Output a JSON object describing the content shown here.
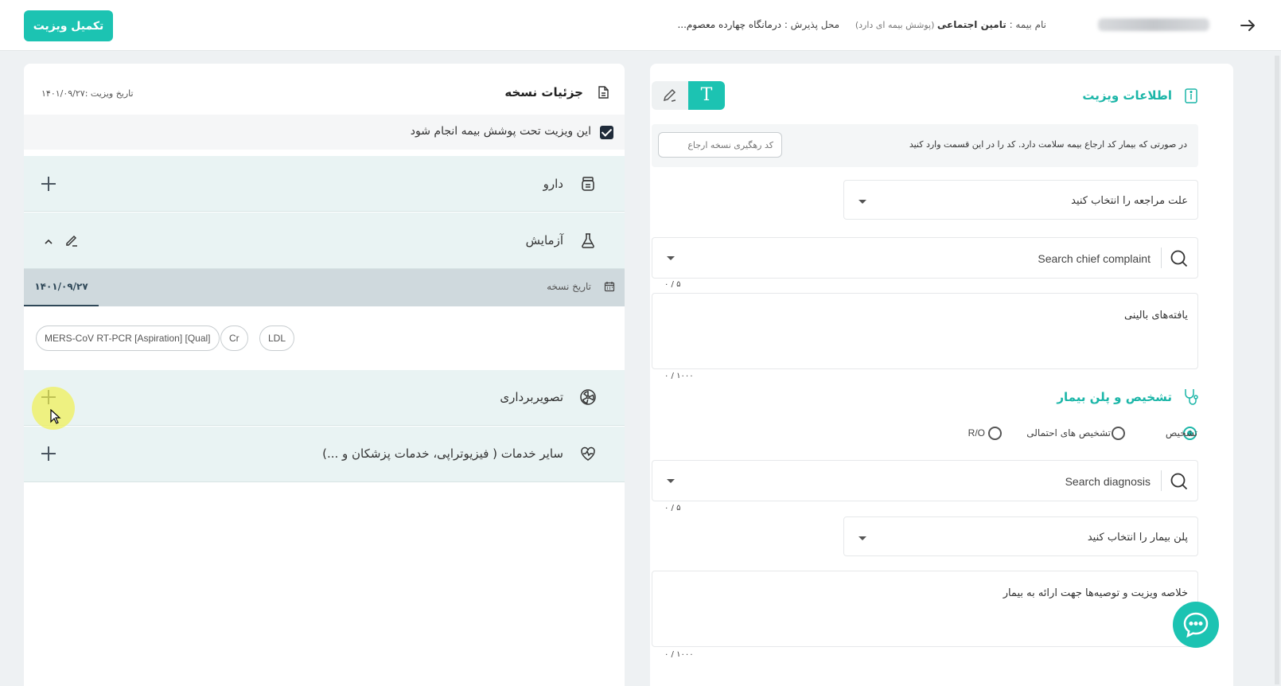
{
  "topbar": {
    "complete_visit_label": "تکمیل ویزیت",
    "insurance_label": "نام بیمه : ",
    "insurance_value": "تامین اجتماعی",
    "insurance_note": " (پوشش بیمه ای دارد)",
    "place_label": "محل پذیرش :",
    "place_value": "درمانگاه چهارده معصوم..."
  },
  "prescription": {
    "title": "جزئیات نسخه",
    "visit_date": "تاریخ ویزیت :۱۴۰۱/۰۹/۲۷",
    "insurance_checkbox_label": "این ویزیت تحت پوشش بیمه انجام شود",
    "insurance_checked": true,
    "sections": {
      "drug": "دارو",
      "lab": "آزمایش",
      "imaging": "تصویربرداری",
      "other": "سایر خدمات ( فیزیوتراپی، خدمات پزشکان و ...)"
    },
    "lab_date_label": "تاریخ نسخه",
    "lab_date_tab": "۱۴۰۱/۰۹/۲۷",
    "lab_tests": [
      "MERS-CoV RT-PCR [Aspiration] [Qual]",
      "Cr",
      "LDL"
    ]
  },
  "visit_info": {
    "title": "اطلاعات ویزیت",
    "referral_text": "در صورتی که بیمار کد ارجاع بیمه سلامت دارد. کد را در این قسمت وارد کنید",
    "referral_placeholder": "کد رهگیری نسخه ارجاع",
    "reason_select": "علت مراجعه را انتخاب کنید",
    "chief_complaint_placeholder": "Search chief complaint",
    "chief_complaint_counter": "۰ / ۵",
    "clinical_findings": "یافته‌های بالینی",
    "clinical_findings_counter": "۰ / ۱۰۰۰"
  },
  "diagnosis": {
    "title": "تشخیص و پلن بیمار",
    "radio_options": [
      "تشخیص",
      "تشخیص های احتمالی",
      "R/O"
    ],
    "selected": "تشخیص",
    "search_placeholder": "Search diagnosis",
    "search_counter": "۰ / ۵",
    "plan_select": "پلن بیمار را انتخاب کنید",
    "summary": "خلاصه ویزیت و توصیه‌ها جهت ارائه به بیمار",
    "summary_counter": "۰ / ۱۰۰۰"
  },
  "colors": {
    "accent": "#1cc3b2",
    "section_bg": "#e9f3f3",
    "tab_strip": "#cfd9dd"
  }
}
